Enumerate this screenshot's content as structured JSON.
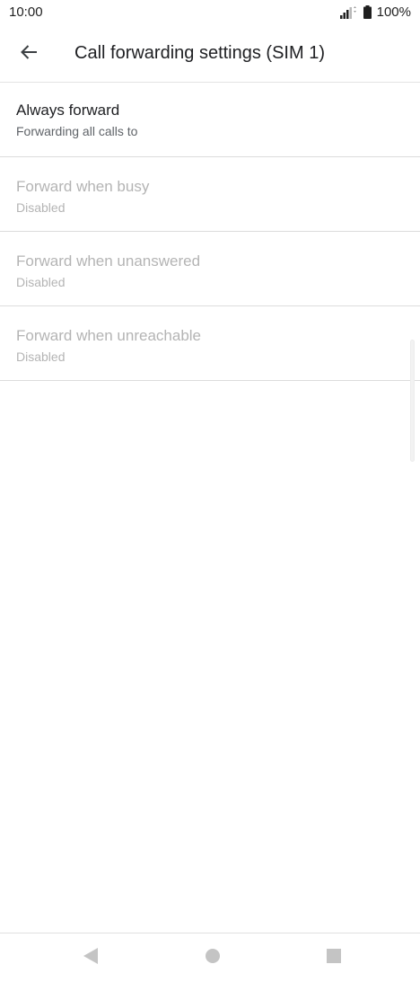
{
  "status_bar": {
    "time": "10:00",
    "battery": "100%",
    "icons": [
      "signal-icon",
      "battery-icon"
    ]
  },
  "toolbar": {
    "title": "Call forwarding settings (SIM 1)",
    "back_icon": "arrow-back-icon"
  },
  "items": [
    {
      "title": "Always forward",
      "summary": "Forwarding all calls to",
      "enabled": true
    },
    {
      "title": "Forward when busy",
      "summary": "Disabled",
      "enabled": false
    },
    {
      "title": "Forward when unanswered",
      "summary": "Disabled",
      "enabled": false
    },
    {
      "title": "Forward when unreachable",
      "summary": "Disabled",
      "enabled": false
    }
  ],
  "nav_bar": {
    "icons": [
      "nav-back-icon",
      "nav-home-icon",
      "nav-recents-icon"
    ]
  },
  "colors": {
    "text_primary": "#202124",
    "text_secondary": "#5f6368",
    "text_disabled": "#b4b4b4",
    "divider": "#dcdcdc",
    "nav_icon": "#c4c4c4"
  }
}
